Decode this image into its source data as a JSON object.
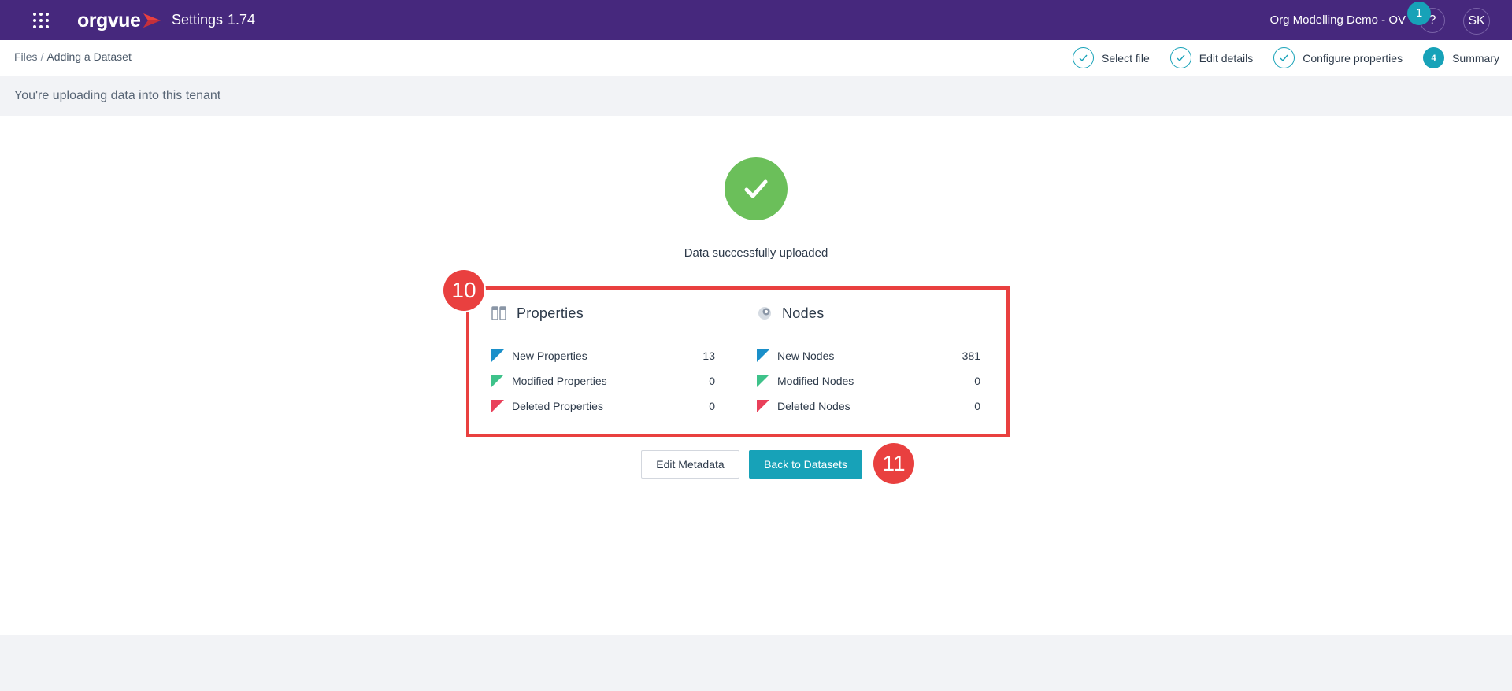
{
  "header": {
    "logo_text": "orgvue",
    "app_name": "Settings",
    "version": "1.74",
    "tenant": "Org Modelling Demo - OV",
    "notifications_count": "1",
    "help_label": "?",
    "user_initials": "SK",
    "colors": {
      "bar": "#46287d",
      "accent": "#17a2b8",
      "logo_mark": "#e9403f"
    }
  },
  "breadcrumb": {
    "root": "Files",
    "separator": "/",
    "current": "Adding a Dataset"
  },
  "steps": [
    {
      "label": "Select file",
      "state": "done"
    },
    {
      "label": "Edit details",
      "state": "done"
    },
    {
      "label": "Configure properties",
      "state": "done"
    },
    {
      "label": "Summary",
      "number": "4",
      "state": "active"
    }
  ],
  "info_bar": {
    "text": "You're uploading data into this tenant"
  },
  "result": {
    "message": "Data successfully uploaded",
    "icon": "check-circle-icon",
    "color": "#6bbf5a"
  },
  "summary": {
    "properties": {
      "title": "Properties",
      "rows": [
        {
          "label": "New Properties",
          "value": "13",
          "flag_color": "#1a8fc9"
        },
        {
          "label": "Modified Properties",
          "value": "0",
          "flag_color": "#3ec28a"
        },
        {
          "label": "Deleted Properties",
          "value": "0",
          "flag_color": "#e9405a"
        }
      ]
    },
    "nodes": {
      "title": "Nodes",
      "rows": [
        {
          "label": "New Nodes",
          "value": "381",
          "flag_color": "#1a8fc9"
        },
        {
          "label": "Modified Nodes",
          "value": "0",
          "flag_color": "#3ec28a"
        },
        {
          "label": "Deleted Nodes",
          "value": "0",
          "flag_color": "#e9405a"
        }
      ]
    }
  },
  "actions": {
    "edit_metadata": "Edit Metadata",
    "back_to_datasets": "Back to Datasets"
  },
  "annotations": {
    "marker_summary": "10",
    "marker_back": "11",
    "color": "#e9403f"
  }
}
